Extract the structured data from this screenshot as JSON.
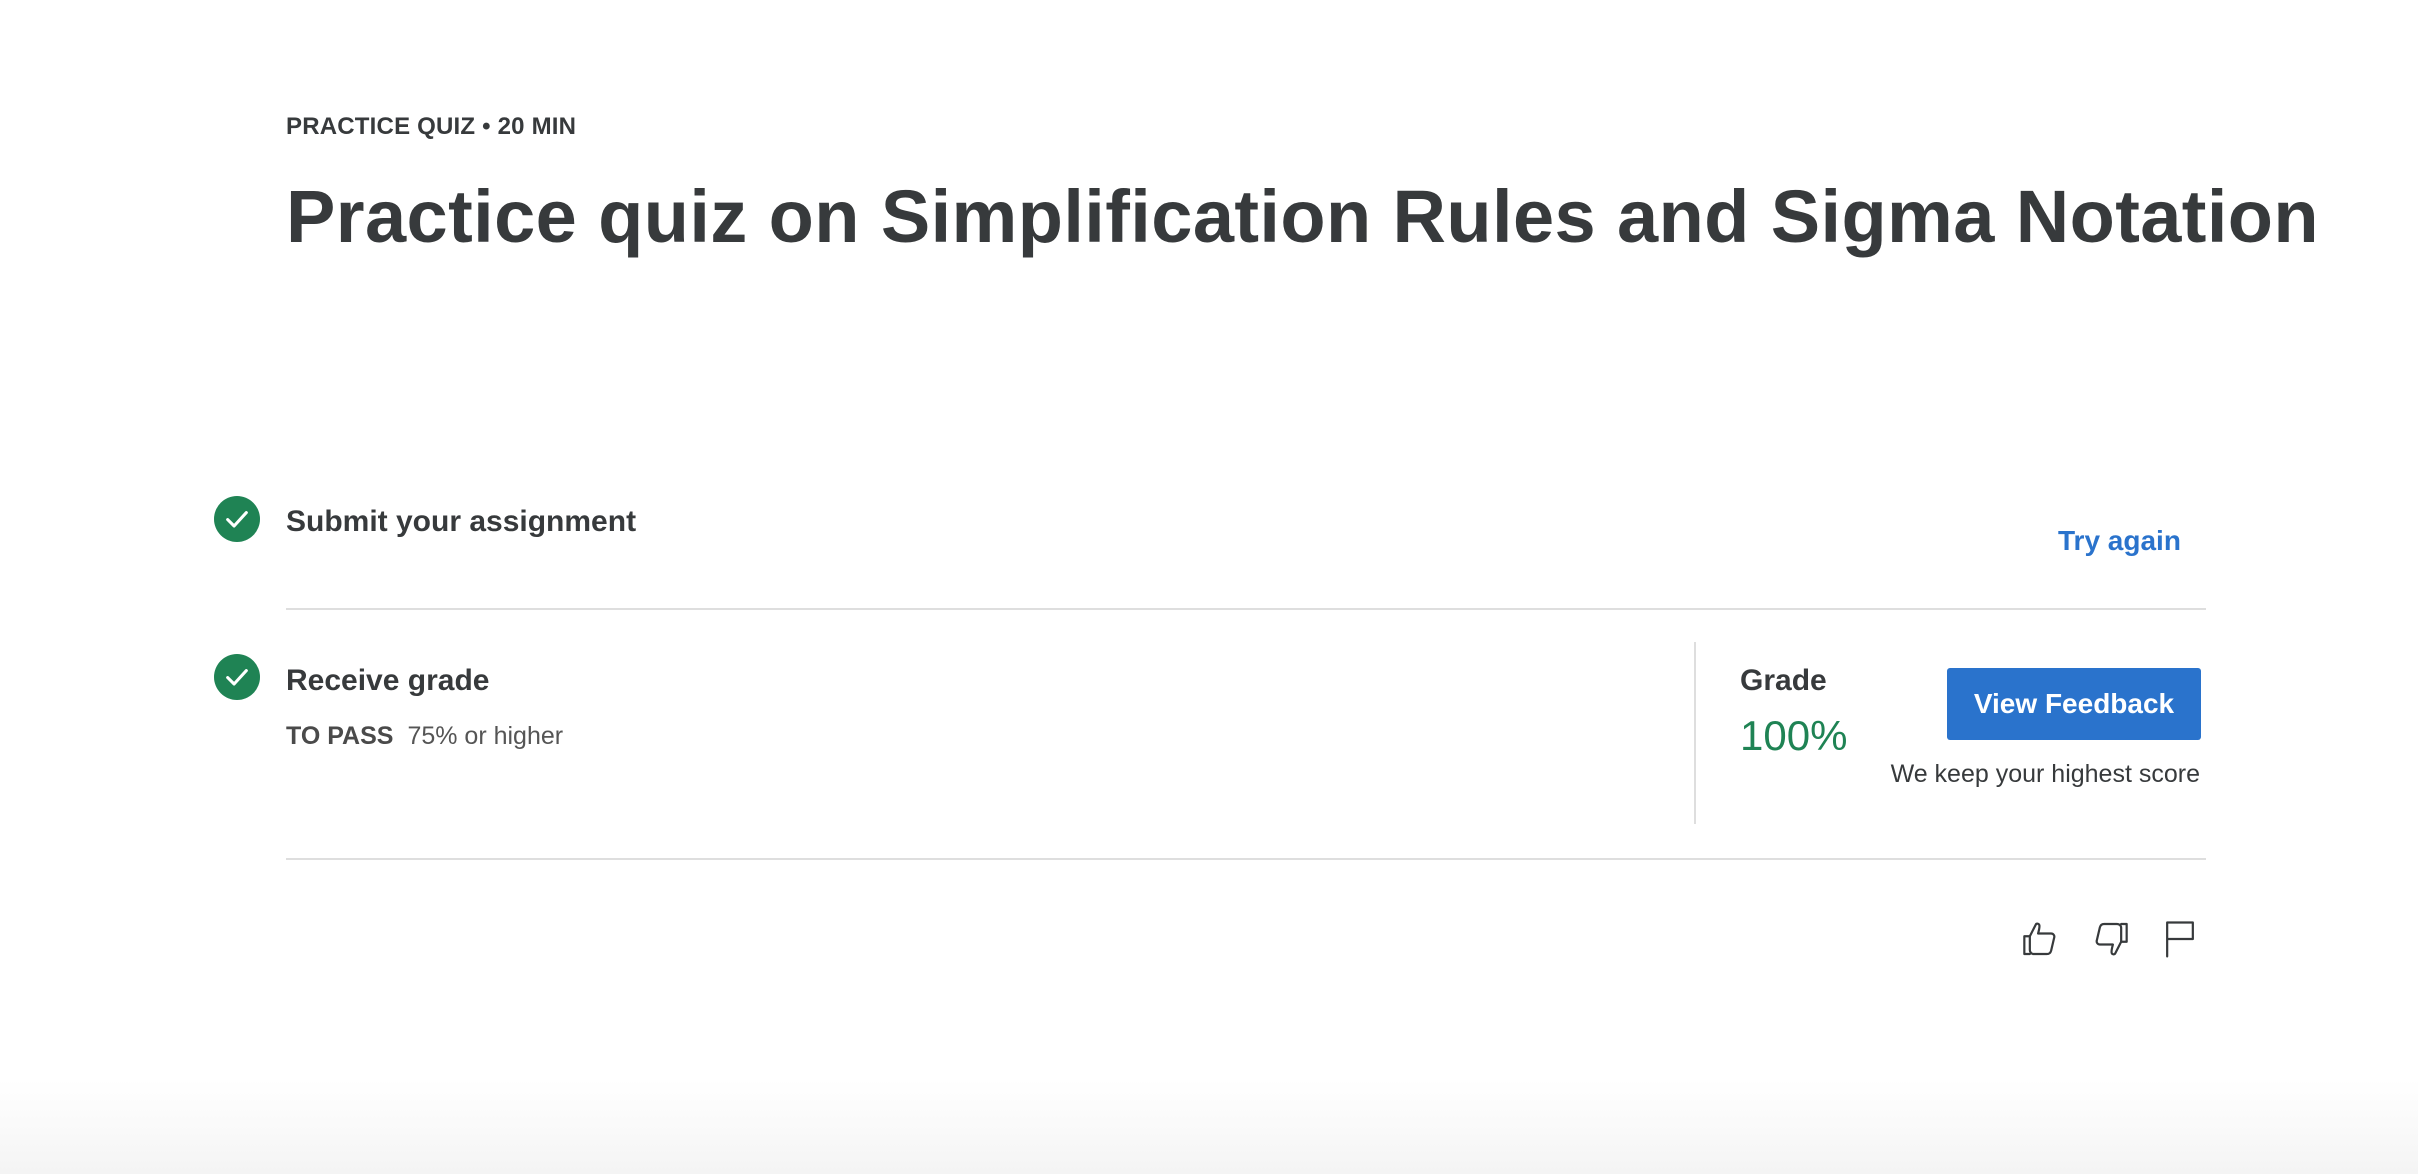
{
  "header": {
    "eyebrow": "PRACTICE QUIZ • 20 MIN",
    "title": "Practice quiz on Simplification Rules and Sigma Notation"
  },
  "steps": [
    {
      "title": "Submit your assignment",
      "status_icon": "check-circle-icon",
      "action_label": "Try again"
    },
    {
      "title": "Receive grade",
      "status_icon": "check-circle-icon",
      "pass_label": "TO PASS",
      "pass_value": "75% or higher"
    }
  ],
  "grade": {
    "label": "Grade",
    "value": "100%",
    "button_label": "View Feedback",
    "note": "We keep your highest score"
  },
  "feedback_actions": [
    {
      "icon": "thumbs-up-icon"
    },
    {
      "icon": "thumbs-down-icon"
    },
    {
      "icon": "flag-icon"
    }
  ],
  "colors": {
    "success": "#1f8354",
    "primary": "#2a73cc",
    "text": "#373a3c",
    "divider": "#dedede"
  }
}
